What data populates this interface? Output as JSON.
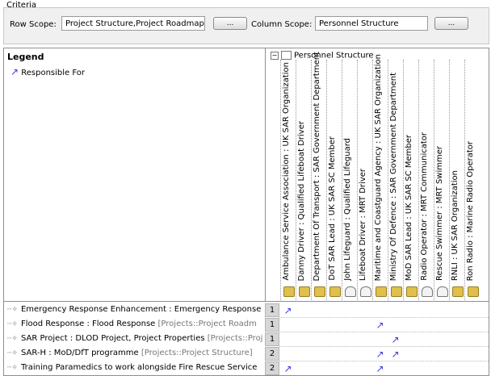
{
  "criteria": {
    "title": "Criteria",
    "row_scope_label": "Row Scope:",
    "row_scope_value": "Project Structure,Project Roadmap",
    "row_scope_button": "...",
    "column_scope_label": "Column Scope:",
    "column_scope_value": "Personnel  Structure",
    "column_scope_button": "..."
  },
  "legend": {
    "title": "Legend",
    "item_label": "Responsible For",
    "arrow_color": "#3a3ad8"
  },
  "columns": {
    "root_label": "Personnel  Structure",
    "root_toggle": "−",
    "items": [
      {
        "label": "Ambulance Service Association : UK SAR Organization",
        "icon": "organization-icon"
      },
      {
        "label": "Danny Driver : Qualified Lifeboat Driver",
        "icon": "organization-icon"
      },
      {
        "label": "Department Of Transport : SAR Government Department",
        "icon": "organization-icon"
      },
      {
        "label": "DoT SAR Lead : UK SAR SC Member",
        "icon": "organization-icon"
      },
      {
        "label": "John Lifeguard : Qualified Lifeguard",
        "icon": "role-icon"
      },
      {
        "label": "Lifeboat Driver : MRT Driver",
        "icon": "role-icon"
      },
      {
        "label": "Maritime and Coastguard Agency : UK SAR Organization",
        "icon": "organization-icon"
      },
      {
        "label": "Ministry Of Defence : SAR Government Department",
        "icon": "organization-icon"
      },
      {
        "label": "MoD SAR Lead : UK SAR SC Member",
        "icon": "organization-icon"
      },
      {
        "label": "Radio Operator : MRT Communicator",
        "icon": "role-icon"
      },
      {
        "label": "Rescue Swimmer : MRT Swimmer",
        "icon": "role-icon"
      },
      {
        "label": "RNLI : UK SAR Organization",
        "icon": "organization-icon"
      },
      {
        "label": "Ron Radio : Marine Radio Operator",
        "icon": "organization-icon"
      }
    ]
  },
  "rows": [
    {
      "label": "Emergency Response Enhancement : Emergency Response",
      "path": "",
      "count": "1",
      "marks": [
        0
      ]
    },
    {
      "label": "Flood Response : Flood Response",
      "path": " [Projects::Project Roadm",
      "count": "1",
      "marks": [
        6
      ]
    },
    {
      "label": "SAR Project : DLOD Project, Project Properties",
      "path": " [Projects::Proj",
      "count": "1",
      "marks": [
        7
      ]
    },
    {
      "label": "SAR-H : MoD/DfT programme",
      "path": " [Projects::Project Structure]",
      "count": "2",
      "marks": [
        6,
        7
      ]
    },
    {
      "label": "Training Paramedics to  work alongside Fire Rescue Service",
      "path": "",
      "count": "2",
      "marks": [
        0,
        6
      ]
    }
  ],
  "row_icon": "project-icon",
  "cell_mark": "↗"
}
